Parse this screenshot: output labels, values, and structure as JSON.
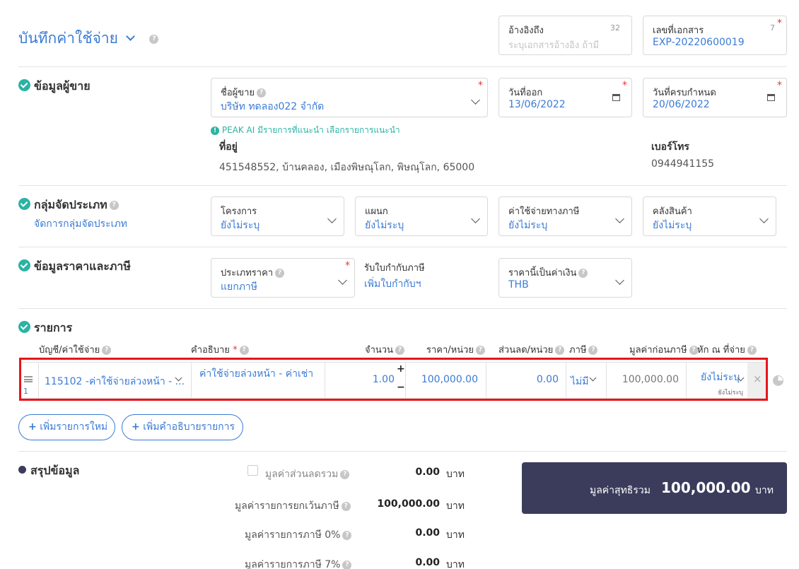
{
  "header": {
    "title": "บันทึกค่าใช้จ่าย",
    "reference": {
      "label": "อ้างอิงถึง",
      "counter": "32",
      "placeholder": "ระบุเอกสารอ้างอิง ถ้ามี"
    },
    "doc_number": {
      "label": "เลขที่เอกสาร",
      "counter": "7",
      "value": "EXP-20220600019",
      "required": "*"
    }
  },
  "vendor": {
    "section_title": "ข้อมูลผู้ขาย",
    "vendor_label": "ชื่อผู้ขาย",
    "vendor_value": "บริษัท ทดลอง022 จำกัด",
    "issue_date_label": "วันที่ออก",
    "issue_date_value": "13/06/2022",
    "due_date_label": "วันที่ครบกำหนด",
    "due_date_value": "20/06/2022",
    "ai_hint": "PEAK AI มีรายการที่แนะนำ",
    "ai_link": "เลือกรายการแนะนำ",
    "address_label": "ที่อยู่",
    "address_value": "451548552, บ้านคลอง, เมืองพิษณุโลก, พิษณุโลก, 65000",
    "phone_label": "เบอร์โทร",
    "phone_value": "0944941155",
    "required": "*"
  },
  "category": {
    "section_title": "กลุ่มจัดประเภท",
    "manage_link": "จัดการกลุ่มจัดประเภท",
    "project_label": "โครงการ",
    "project_value": "ยังไม่ระบุ",
    "department_label": "แผนก",
    "department_value": "ยังไม่ระบุ",
    "tax_expense_label": "ค่าใช้จ่ายทางภาษี",
    "tax_expense_value": "ยังไม่ระบุ",
    "warehouse_label": "คลังสินค้า",
    "warehouse_value": "ยังไม่ระบุ"
  },
  "pricing": {
    "section_title": "ข้อมูลราคาและภาษี",
    "price_type_label": "ประเภทราคา",
    "price_type_value": "แยกภาษี",
    "tax_invoice_label": "รับใบกำกับภาษี",
    "tax_invoice_link": "เพิ่มใบกำกับฯ",
    "currency_label": "ราคานี้เป็นค่าเงิน",
    "currency_value": "THB",
    "required": "*"
  },
  "items": {
    "section_title": "รายการ",
    "columns": {
      "account": "บัญชี/ค่าใช้จ่าย",
      "description": "คำอธิบาย",
      "quantity": "จำนวน",
      "unit_price": "ราคา/หน่วย",
      "discount": "ส่วนลด/หน่วย",
      "tax": "ภาษี",
      "pre_tax": "มูลค่าก่อนภาษี",
      "withholding": "หัก ณ ที่จ่าย"
    },
    "rows": [
      {
        "index": "1",
        "account": "115102 -ค่าใช้จ่ายล่วงหน้า - ...",
        "description": "ค่าใช้จ่ายล่วงหน้า - ค่าเช่า",
        "quantity": "1.00",
        "unit_price": "100,000.00",
        "discount": "0.00",
        "tax": "ไม่มี",
        "pre_tax": "100,000.00",
        "withholding": "ยังไม่ระบุ",
        "withholding_sub": "ยังไม่ระบุ"
      }
    ],
    "add_item_button": "เพิ่มรายการใหม่",
    "add_description_button": "เพิ่มคำอธิบายรายการ",
    "required": "*",
    "plus": "+",
    "minus": "−",
    "remove": "×"
  },
  "summary": {
    "section_title": "สรุปข้อมูล",
    "rows": [
      {
        "label": "มูลค่าส่วนลดรวม",
        "value": "0.00",
        "unit": "บาท"
      },
      {
        "label": "มูลค่ารายการยกเว้นภาษี",
        "value": "100,000.00",
        "unit": "บาท"
      },
      {
        "label": "มูลค่ารายการภาษี 0%",
        "value": "0.00",
        "unit": "บาท"
      },
      {
        "label": "มูลค่ารายการภาษี 7%",
        "value": "0.00",
        "unit": "บาท"
      }
    ],
    "net_total_label": "มูลค่าสุทธิรวม",
    "net_total_value": "100,000.00",
    "net_total_unit": "บาท"
  },
  "colors": {
    "accent": "#3a7bd5",
    "check": "#2bb3a3",
    "required": "#e53935",
    "highlight": "#e8141b",
    "total_bg": "#3b3c5c"
  }
}
